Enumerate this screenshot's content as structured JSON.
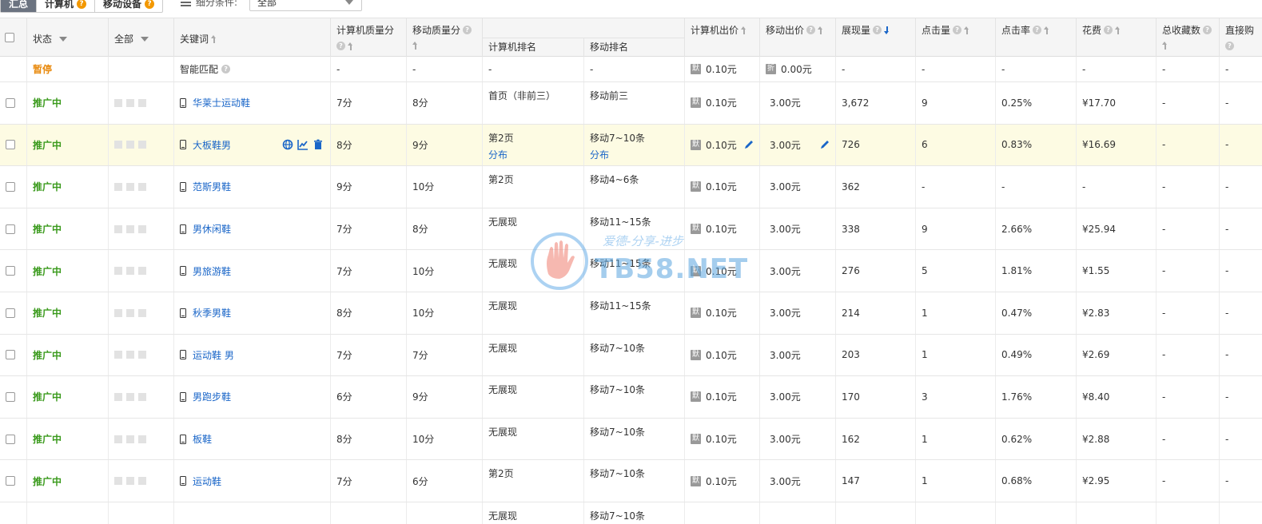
{
  "toolbar": {
    "tabs": [
      {
        "label": "汇总",
        "active": true
      },
      {
        "label": "计算机",
        "badge": "?"
      },
      {
        "label": "移动设备",
        "badge": "?"
      }
    ],
    "filter_label": "细分条件:",
    "filter_value": "全部"
  },
  "header": {
    "status": "状态",
    "all": "全部",
    "keyword": "关键词",
    "pc_quality": "计算机质量分",
    "mobile_quality": "移动质量分",
    "pc_rank": "计算机排名",
    "mobile_rank": "移动排名",
    "pc_bid": "计算机出价",
    "mobile_bid": "移动出价",
    "impressions": "展现量",
    "clicks": "点击量",
    "ctr": "点击率",
    "cost": "花费",
    "favorites": "总收藏数",
    "direct": "直接购"
  },
  "smart_row": {
    "status": "暂停",
    "keyword": "智能匹配",
    "pc_quality": "-",
    "mobile_quality": "-",
    "pc_rank": "-",
    "mobile_rank": "-",
    "pc_bid_tag": "默",
    "pc_bid": "0.10元",
    "mobile_bid_tag": "折",
    "mobile_bid": "0.00元",
    "impressions": "-",
    "clicks": "-",
    "ctr": "-",
    "cost": "-",
    "favorites": "-",
    "direct": "-"
  },
  "rows": [
    {
      "status": "推广中",
      "keyword": "华莱士运动鞋",
      "pcq": "7分",
      "mq": "8分",
      "pcr": "首页（非前三）",
      "pcr2": "",
      "mr": "移动前三",
      "mr2": "",
      "bid_tag": "默",
      "pcb": "0.10元",
      "mb": "3.00元",
      "imp": "3,672",
      "clk": "9",
      "ctr": "0.25%",
      "cost": "¥17.70",
      "fav": "-",
      "dir": "-"
    },
    {
      "status": "推广中",
      "keyword": "大板鞋男",
      "pcq": "8分",
      "mq": "9分",
      "pcr": "第2页",
      "pcr2": "分布",
      "mr": "移动7~10条",
      "mr2": "分布",
      "bid_tag": "默",
      "pcb": "0.10元",
      "mb": "3.00元",
      "imp": "726",
      "clk": "6",
      "ctr": "0.83%",
      "cost": "¥16.69",
      "fav": "-",
      "dir": "-"
    },
    {
      "status": "推广中",
      "keyword": "范斯男鞋",
      "pcq": "9分",
      "mq": "10分",
      "pcr": "第2页",
      "pcr2": "",
      "mr": "移动4~6条",
      "mr2": "",
      "bid_tag": "默",
      "pcb": "0.10元",
      "mb": "3.00元",
      "imp": "362",
      "clk": "-",
      "ctr": "-",
      "cost": "-",
      "fav": "-",
      "dir": "-"
    },
    {
      "status": "推广中",
      "keyword": "男休闲鞋",
      "pcq": "7分",
      "mq": "8分",
      "pcr": "无展现",
      "pcr2": "",
      "mr": "移动11~15条",
      "mr2": "",
      "bid_tag": "默",
      "pcb": "0.10元",
      "mb": "3.00元",
      "imp": "338",
      "clk": "9",
      "ctr": "2.66%",
      "cost": "¥25.94",
      "fav": "-",
      "dir": "-"
    },
    {
      "status": "推广中",
      "keyword": "男旅游鞋",
      "pcq": "7分",
      "mq": "10分",
      "pcr": "无展现",
      "pcr2": "",
      "mr": "移动11~15条",
      "mr2": "",
      "bid_tag": "默",
      "pcb": "0.10元",
      "mb": "3.00元",
      "imp": "276",
      "clk": "5",
      "ctr": "1.81%",
      "cost": "¥1.55",
      "fav": "-",
      "dir": "-"
    },
    {
      "status": "推广中",
      "keyword": "秋季男鞋",
      "pcq": "8分",
      "mq": "10分",
      "pcr": "无展现",
      "pcr2": "",
      "mr": "移动11~15条",
      "mr2": "",
      "bid_tag": "默",
      "pcb": "0.10元",
      "mb": "3.00元",
      "imp": "214",
      "clk": "1",
      "ctr": "0.47%",
      "cost": "¥2.83",
      "fav": "-",
      "dir": "-"
    },
    {
      "status": "推广中",
      "keyword": "运动鞋 男",
      "pcq": "7分",
      "mq": "7分",
      "pcr": "无展现",
      "pcr2": "",
      "mr": "移动7~10条",
      "mr2": "",
      "bid_tag": "默",
      "pcb": "0.10元",
      "mb": "3.00元",
      "imp": "203",
      "clk": "1",
      "ctr": "0.49%",
      "cost": "¥2.69",
      "fav": "-",
      "dir": "-"
    },
    {
      "status": "推广中",
      "keyword": "男跑步鞋",
      "pcq": "6分",
      "mq": "9分",
      "pcr": "无展现",
      "pcr2": "",
      "mr": "移动7~10条",
      "mr2": "",
      "bid_tag": "默",
      "pcb": "0.10元",
      "mb": "3.00元",
      "imp": "170",
      "clk": "3",
      "ctr": "1.76%",
      "cost": "¥8.40",
      "fav": "-",
      "dir": "-"
    },
    {
      "status": "推广中",
      "keyword": "板鞋",
      "pcq": "8分",
      "mq": "10分",
      "pcr": "无展现",
      "pcr2": "",
      "mr": "移动7~10条",
      "mr2": "",
      "bid_tag": "默",
      "pcb": "0.10元",
      "mb": "3.00元",
      "imp": "162",
      "clk": "1",
      "ctr": "0.62%",
      "cost": "¥2.88",
      "fav": "-",
      "dir": "-"
    },
    {
      "status": "推广中",
      "keyword": "运动鞋",
      "pcq": "7分",
      "mq": "6分",
      "pcr": "第2页",
      "pcr2": "",
      "mr": "移动7~10条",
      "mr2": "",
      "bid_tag": "默",
      "pcb": "0.10元",
      "mb": "3.00元",
      "imp": "147",
      "clk": "1",
      "ctr": "0.68%",
      "cost": "¥2.95",
      "fav": "-",
      "dir": "-"
    },
    {
      "status": "",
      "keyword": "",
      "pcq": "",
      "mq": "",
      "pcr": "无展现",
      "pcr2": "",
      "mr": "移动7~10条",
      "mr2": "",
      "bid_tag": "",
      "pcb": "",
      "mb": "",
      "imp": "",
      "clk": "",
      "ctr": "",
      "cost": "",
      "fav": "",
      "dir": ""
    }
  ],
  "watermark": {
    "slogan": "爱德-分享-进步",
    "brand": "TB58.NET"
  },
  "colors": {
    "link": "#1a66c8",
    "status_on": "#3a9a1c",
    "status_pause": "#e8890c",
    "highlight_row": "#fdfbe3"
  }
}
